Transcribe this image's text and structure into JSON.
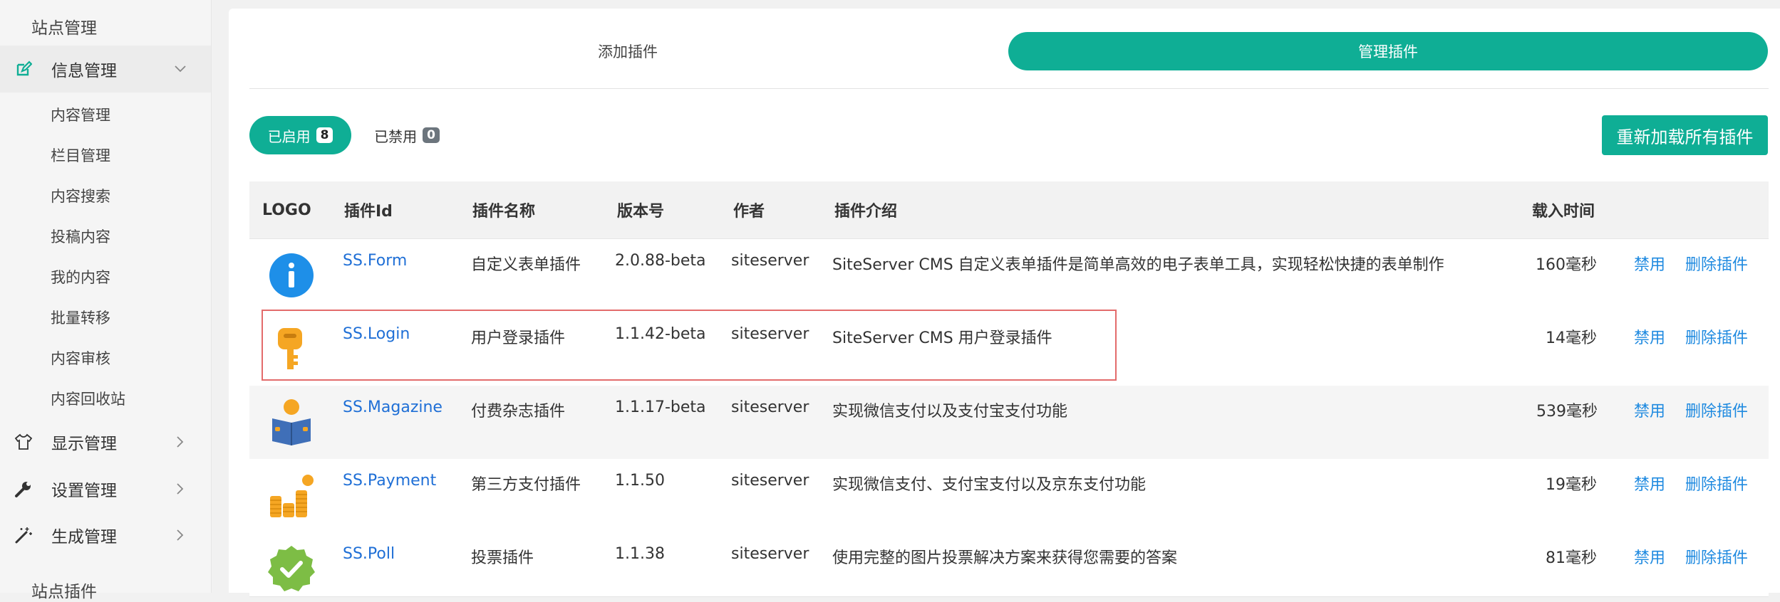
{
  "sidebar": {
    "section_top": "站点管理",
    "groups": [
      {
        "label": "信息管理",
        "icon": "edit-icon"
      },
      {
        "label": "显示管理",
        "icon": "tshirt-icon"
      },
      {
        "label": "设置管理",
        "icon": "wrench-icon"
      },
      {
        "label": "生成管理",
        "icon": "magic-wand-icon"
      }
    ],
    "items": [
      "内容管理",
      "栏目管理",
      "内容搜索",
      "投稿内容",
      "我的内容",
      "批量转移",
      "内容审核",
      "内容回收站"
    ],
    "section_bottom": "站点插件"
  },
  "tabs": {
    "add": "添加插件",
    "manage": "管理插件"
  },
  "filters": {
    "enabled_label": "已启用",
    "enabled_count": "8",
    "disabled_label": "已禁用",
    "disabled_count": "0"
  },
  "reload_button": "重新加载所有插件",
  "table": {
    "headers": [
      "LOGO",
      "插件Id",
      "插件名称",
      "版本号",
      "作者",
      "插件介绍",
      "载入时间"
    ],
    "rows": [
      {
        "id": "SS.Form",
        "name": "自定义表单插件",
        "version": "2.0.88-beta",
        "author": "siteserver",
        "desc": "SiteServer CMS 自定义表单插件是简单高效的电子表单工具，实现轻松快捷的表单制作",
        "time": "160毫秒",
        "disable": "禁用",
        "delete": "删除插件",
        "logo": "info-icon"
      },
      {
        "id": "SS.Login",
        "name": "用户登录插件",
        "version": "1.1.42-beta",
        "author": "siteserver",
        "desc": "SiteServer CMS 用户登录插件",
        "time": "14毫秒",
        "disable": "禁用",
        "delete": "删除插件",
        "logo": "key-icon"
      },
      {
        "id": "SS.Magazine",
        "name": "付费杂志插件",
        "version": "1.1.17-beta",
        "author": "siteserver",
        "desc": "实现微信支付以及支付宝支付功能",
        "time": "539毫秒",
        "disable": "禁用",
        "delete": "删除插件",
        "logo": "reader-icon"
      },
      {
        "id": "SS.Payment",
        "name": "第三方支付插件",
        "version": "1.1.50",
        "author": "siteserver",
        "desc": "实现微信支付、支付宝支付以及京东支付功能",
        "time": "19毫秒",
        "disable": "禁用",
        "delete": "删除插件",
        "logo": "coins-icon"
      },
      {
        "id": "SS.Poll",
        "name": "投票插件",
        "version": "1.1.38",
        "author": "siteserver",
        "desc": "使用完整的图片投票解决方案来获得您需要的答案",
        "time": "81毫秒",
        "disable": "禁用",
        "delete": "删除插件",
        "logo": "check-badge-icon"
      }
    ]
  },
  "colors": {
    "accent": "#0fae95",
    "link": "#1f6fd6",
    "highlight": "#e36b6b"
  }
}
